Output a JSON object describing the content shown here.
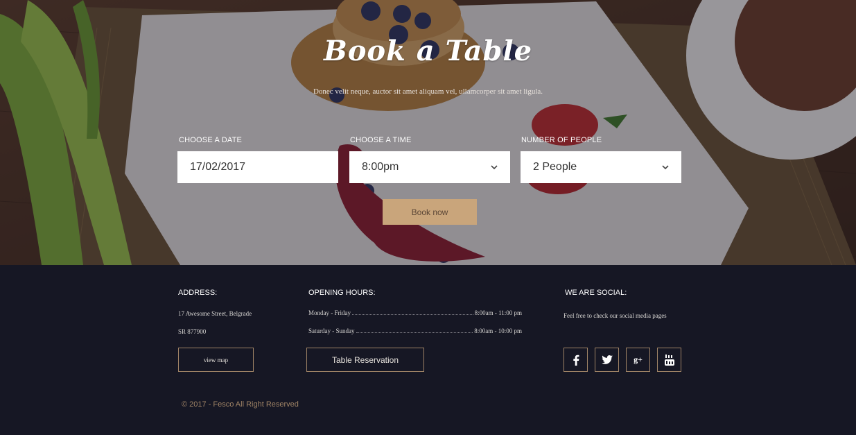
{
  "hero": {
    "title": "Book a Table",
    "subtitle": "Donec velit neque, auctor sit amet aliquam vel, ullamcorper sit amet ligula."
  },
  "booking": {
    "date": {
      "label": "CHOOSE A DATE",
      "value": "17/02/2017"
    },
    "time": {
      "label": "CHOOSE A TIME",
      "value": "8:00pm"
    },
    "people": {
      "label": "NUMBER OF PEOPLE",
      "value": "2 People"
    },
    "submit_label": "Book now"
  },
  "footer": {
    "address": {
      "heading": "ADDRESS:",
      "line1": "17 Awesome Street, Belgrade",
      "line2": "SR 877900",
      "button_label": "view map"
    },
    "hours": {
      "heading": "OPENING HOURS:",
      "rows": [
        {
          "day": "Monday - Friday",
          "time": "8:00am - 11:00 pm"
        },
        {
          "day": "Saturday - Sunday",
          "time": "8:00am - 10:00 pm"
        }
      ],
      "button_label": "Table Reservation"
    },
    "social": {
      "heading": "WE ARE SOCIAL:",
      "text": "Feel free to check our social media pages",
      "icons": [
        {
          "name": "facebook-icon",
          "glyph": "f"
        },
        {
          "name": "twitter-icon",
          "glyph": "twitter"
        },
        {
          "name": "google-plus-icon",
          "glyph": "g+"
        },
        {
          "name": "youtube-icon",
          "glyph": "youtube"
        }
      ]
    },
    "copyright": "© 2017 - Fesco All Right Reserved"
  },
  "colors": {
    "accent": "#c9a57b",
    "footer_bg": "#161724",
    "border_accent": "#a08466"
  }
}
